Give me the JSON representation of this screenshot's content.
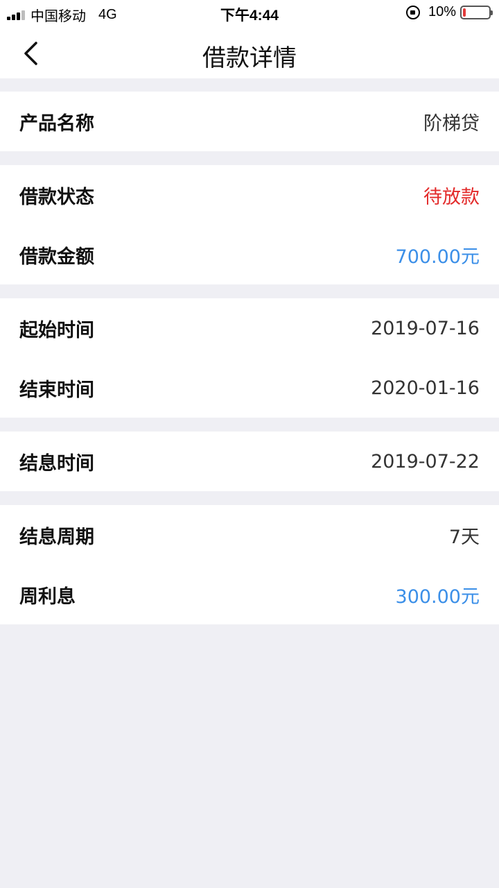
{
  "status_bar": {
    "carrier": "中国移动",
    "network": "4G",
    "time": "下午4:44",
    "battery_percent": "10%",
    "battery_level": 0.1,
    "battery_color": "#e33b3b"
  },
  "nav": {
    "title": "借款详情",
    "back_icon": "chevron-left-icon"
  },
  "colors": {
    "background": "#efeff4",
    "status_red": "#e32a2a",
    "amount_blue": "#3b8fe8"
  },
  "details": {
    "product_name": {
      "label": "产品名称",
      "value": "阶梯贷"
    },
    "loan_status": {
      "label": "借款状态",
      "value": "待放款"
    },
    "loan_amount": {
      "label": "借款金额",
      "value": "700.00元"
    },
    "start_time": {
      "label": "起始时间",
      "value": "2019-07-16"
    },
    "end_time": {
      "label": "结束时间",
      "value": "2020-01-16"
    },
    "settlement_time": {
      "label": "结息时间",
      "value": "2019-07-22"
    },
    "settlement_cycle": {
      "label": "结息周期",
      "value": "7天"
    },
    "weekly_interest": {
      "label": "周利息",
      "value": "300.00元"
    }
  }
}
